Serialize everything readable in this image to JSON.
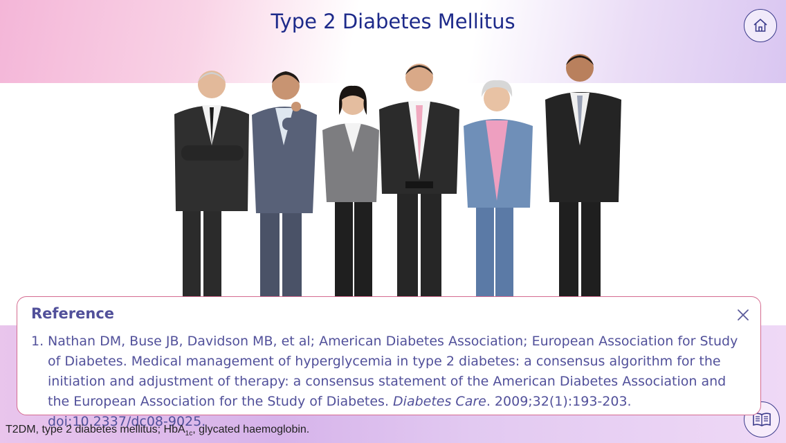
{
  "header": {
    "title": "Type 2 Diabetes Mellitus"
  },
  "home": {
    "icon": "home-icon"
  },
  "reference": {
    "heading": "Reference",
    "close_icon": "close-icon",
    "items": [
      {
        "number": "1.",
        "text_before": "Nathan DM, Buse JB, Davidson MB, et al; American Diabetes Association; European Association for Study of Diabetes. Medical management of hyperglycemia in type 2 diabetes: a consensus algorithm for the initiation and adjustment of therapy: a consensus statement of the American Diabetes Association and the European Association for the Study of Diabetes. ",
        "journal": "Diabetes Care",
        "text_after": ". 2009;32(1):193-203. doi:10.2337/dc08-9025."
      }
    ]
  },
  "footnote": {
    "part1": "T2DM, type 2 diabetes mellitus; HbA",
    "sub": "1c",
    "part2": ", glycated haemoglobin."
  },
  "references_button": {
    "icon": "book-icon"
  },
  "colors": {
    "title": "#1d2a8a",
    "panel_text": "#51509a",
    "panel_border": "#d46a8f",
    "icon_stroke": "#3a3a8a"
  }
}
